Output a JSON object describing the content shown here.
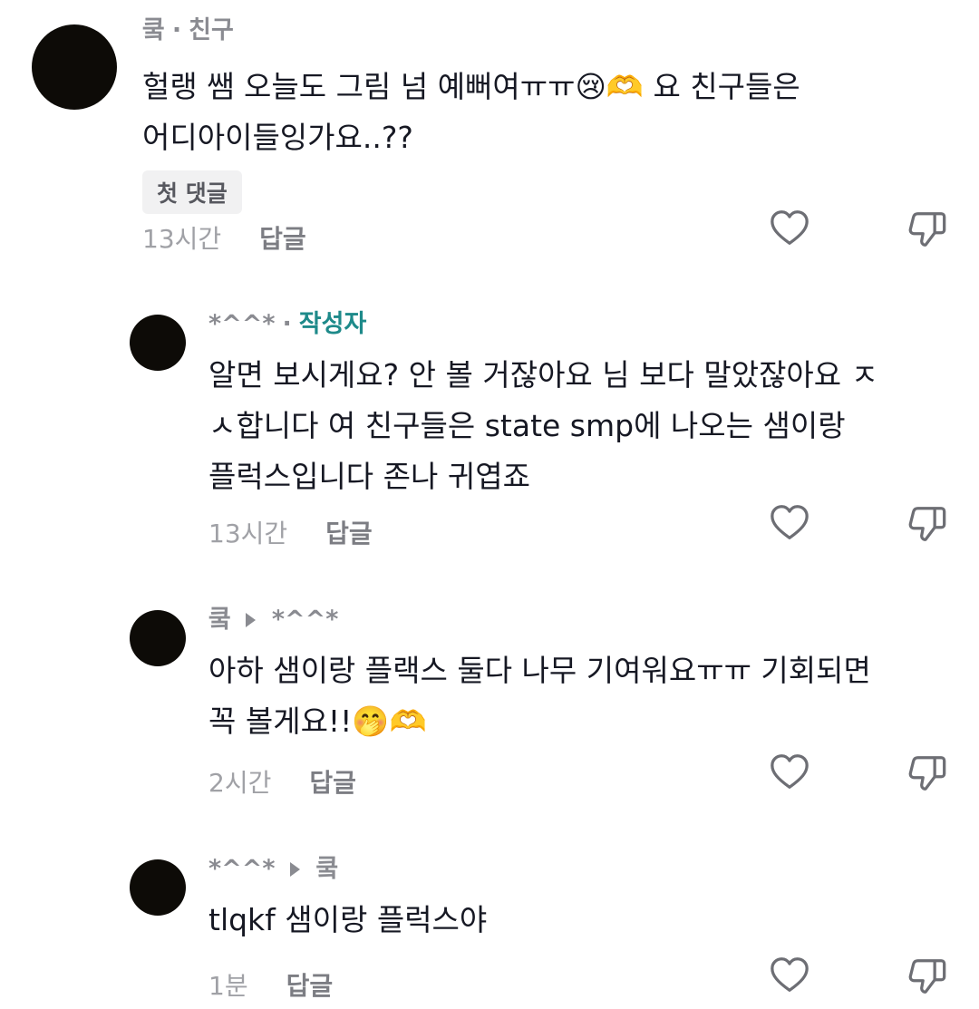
{
  "comments": [
    {
      "author": "쿸",
      "separator": "·",
      "relation": "친구",
      "text": "헐랭 쌤 오늘도 그림 넘 예뻐여ㅠㅠ😢🫶 요 친구들은\n어디아이들잉가요..??",
      "badge": "첫 댓글",
      "time": "13시간",
      "reply_label": "답글"
    },
    {
      "author": "*^^*",
      "separator": "·",
      "relation": "작성자",
      "text": "알면 보시게요? 안 볼 거잖아요 님 보다 말았잖아요 ㅈ\nㅅ합니다 여 친구들은 state smp에 나오는 샘이랑\n플럭스입니다 존나 귀엽죠",
      "time": "13시간",
      "reply_label": "답글"
    },
    {
      "author": "쿸",
      "reply_to": "*^^*",
      "text": "아하 샘이랑 플랙스 둘다 나무 기여워요ㅠㅠ 기회되면\n꼭 볼게요!!🤭🫶",
      "time": "2시간",
      "reply_label": "답글"
    },
    {
      "author": "*^^*",
      "reply_to": "쿸",
      "text": "tlqkf 샘이랑 플럭스야",
      "time": "1분",
      "reply_label": "답글"
    }
  ],
  "icons": {
    "like": "heart-outline-icon",
    "dislike": "thumbs-down-outline-icon"
  },
  "colors": {
    "author_tag": "#1e8a8a",
    "meta_gray": "#8a8b91",
    "avatar": "#0d0b07"
  }
}
